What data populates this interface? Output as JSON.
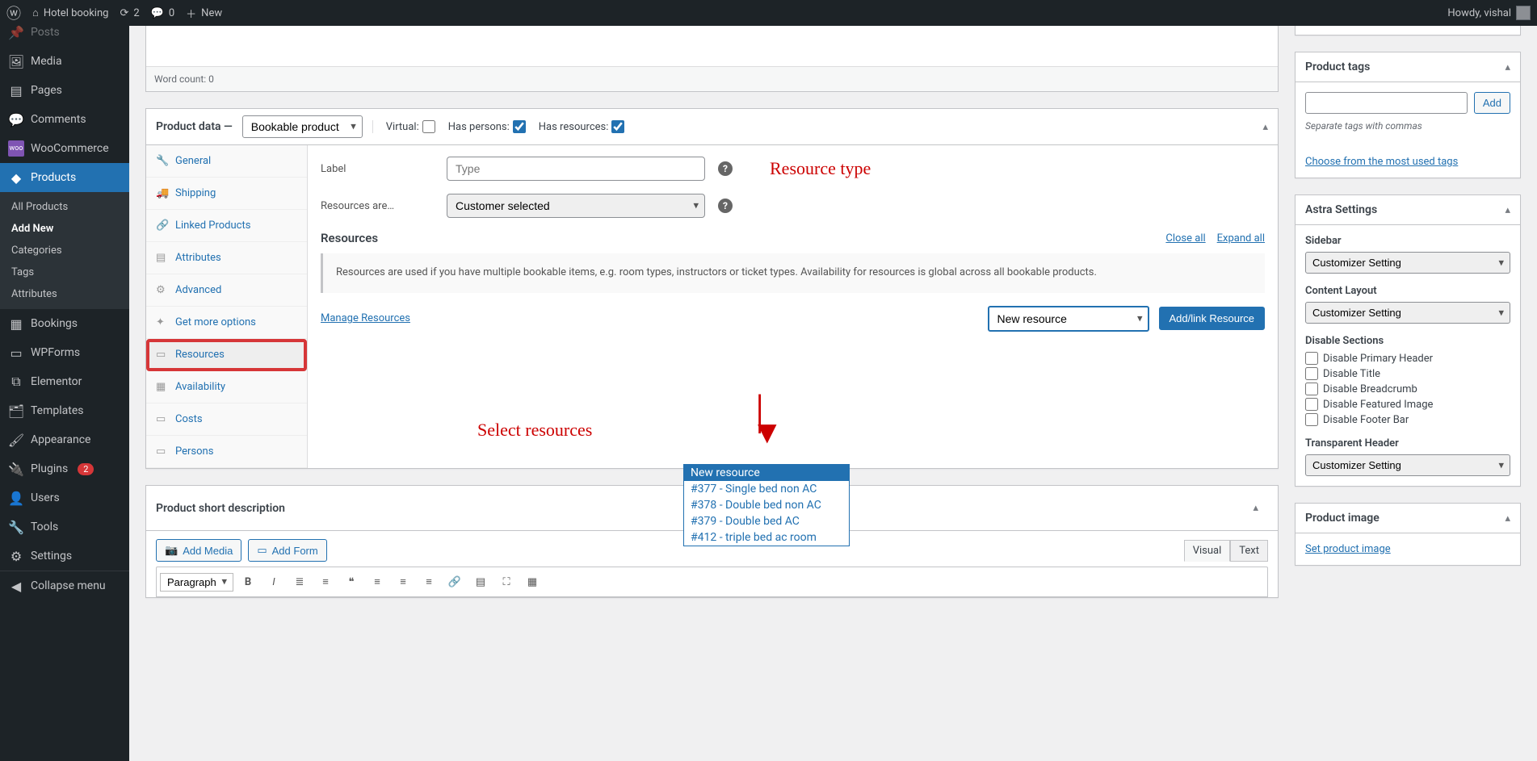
{
  "adminBar": {
    "siteTitle": "Hotel booking",
    "updates": "2",
    "comments": "0",
    "new": "New",
    "howdy": "Howdy, vishal"
  },
  "sidebar": {
    "items": [
      {
        "label": "Posts"
      },
      {
        "label": "Media"
      },
      {
        "label": "Pages"
      },
      {
        "label": "Comments"
      },
      {
        "label": "WooCommerce"
      },
      {
        "label": "Products"
      },
      {
        "label": "Bookings"
      },
      {
        "label": "WPForms"
      },
      {
        "label": "Elementor"
      },
      {
        "label": "Templates"
      },
      {
        "label": "Appearance"
      },
      {
        "label": "Plugins"
      },
      {
        "label": "Users"
      },
      {
        "label": "Tools"
      },
      {
        "label": "Settings"
      }
    ],
    "submenu": [
      "All Products",
      "Add New",
      "Categories",
      "Tags",
      "Attributes"
    ],
    "plugins_badge": "2",
    "collapse": "Collapse menu"
  },
  "editor": {
    "wordCount": "Word count: 0"
  },
  "productData": {
    "title": "Product data —",
    "type": "Bookable product",
    "virtual": "Virtual:",
    "hasPersons": "Has persons:",
    "hasResources": "Has resources:",
    "tabs": [
      "General",
      "Shipping",
      "Linked Products",
      "Attributes",
      "Advanced",
      "Get more options",
      "Resources",
      "Availability",
      "Costs",
      "Persons"
    ],
    "labelLabel": "Label",
    "labelPlaceholder": "Type",
    "resourcesAre": "Resources are…",
    "resourcesAreValue": "Customer selected",
    "resourcesHeading": "Resources",
    "closeAll": "Close all",
    "expandAll": "Expand all",
    "infoText": "Resources are used if you have multiple bookable items, e.g. room types, instructors or ticket types. Availability for resources is global across all bookable products.",
    "manageLink": "Manage Resources",
    "newResource": "New resource",
    "addLink": "Add/link Resource",
    "options": [
      "New resource",
      "#377 - Single bed non AC",
      "#378 - Double bed non AC",
      "#379 - Double bed AC",
      "#412 - triple bed ac room"
    ]
  },
  "annotations": {
    "resourceType": "Resource type",
    "selectResources": "Select resources"
  },
  "shortDesc": {
    "title": "Product short description",
    "addMedia": "Add Media",
    "addForm": "Add Form",
    "visual": "Visual",
    "text": "Text",
    "paragraph": "Paragraph"
  },
  "tags": {
    "title": "Product tags",
    "add": "Add",
    "hint": "Separate tags with commas",
    "chooseLink": "Choose from the most used tags"
  },
  "astra": {
    "title": "Astra Settings",
    "sidebar": "Sidebar",
    "sidebarVal": "Customizer Setting",
    "contentLayout": "Content Layout",
    "contentLayoutVal": "Customizer Setting",
    "disableSections": "Disable Sections",
    "disableOpts": [
      "Disable Primary Header",
      "Disable Title",
      "Disable Breadcrumb",
      "Disable Featured Image",
      "Disable Footer Bar"
    ],
    "transparentHeader": "Transparent Header",
    "transparentHeaderVal": "Customizer Setting"
  },
  "productImage": {
    "title": "Product image",
    "link": "Set product image"
  }
}
